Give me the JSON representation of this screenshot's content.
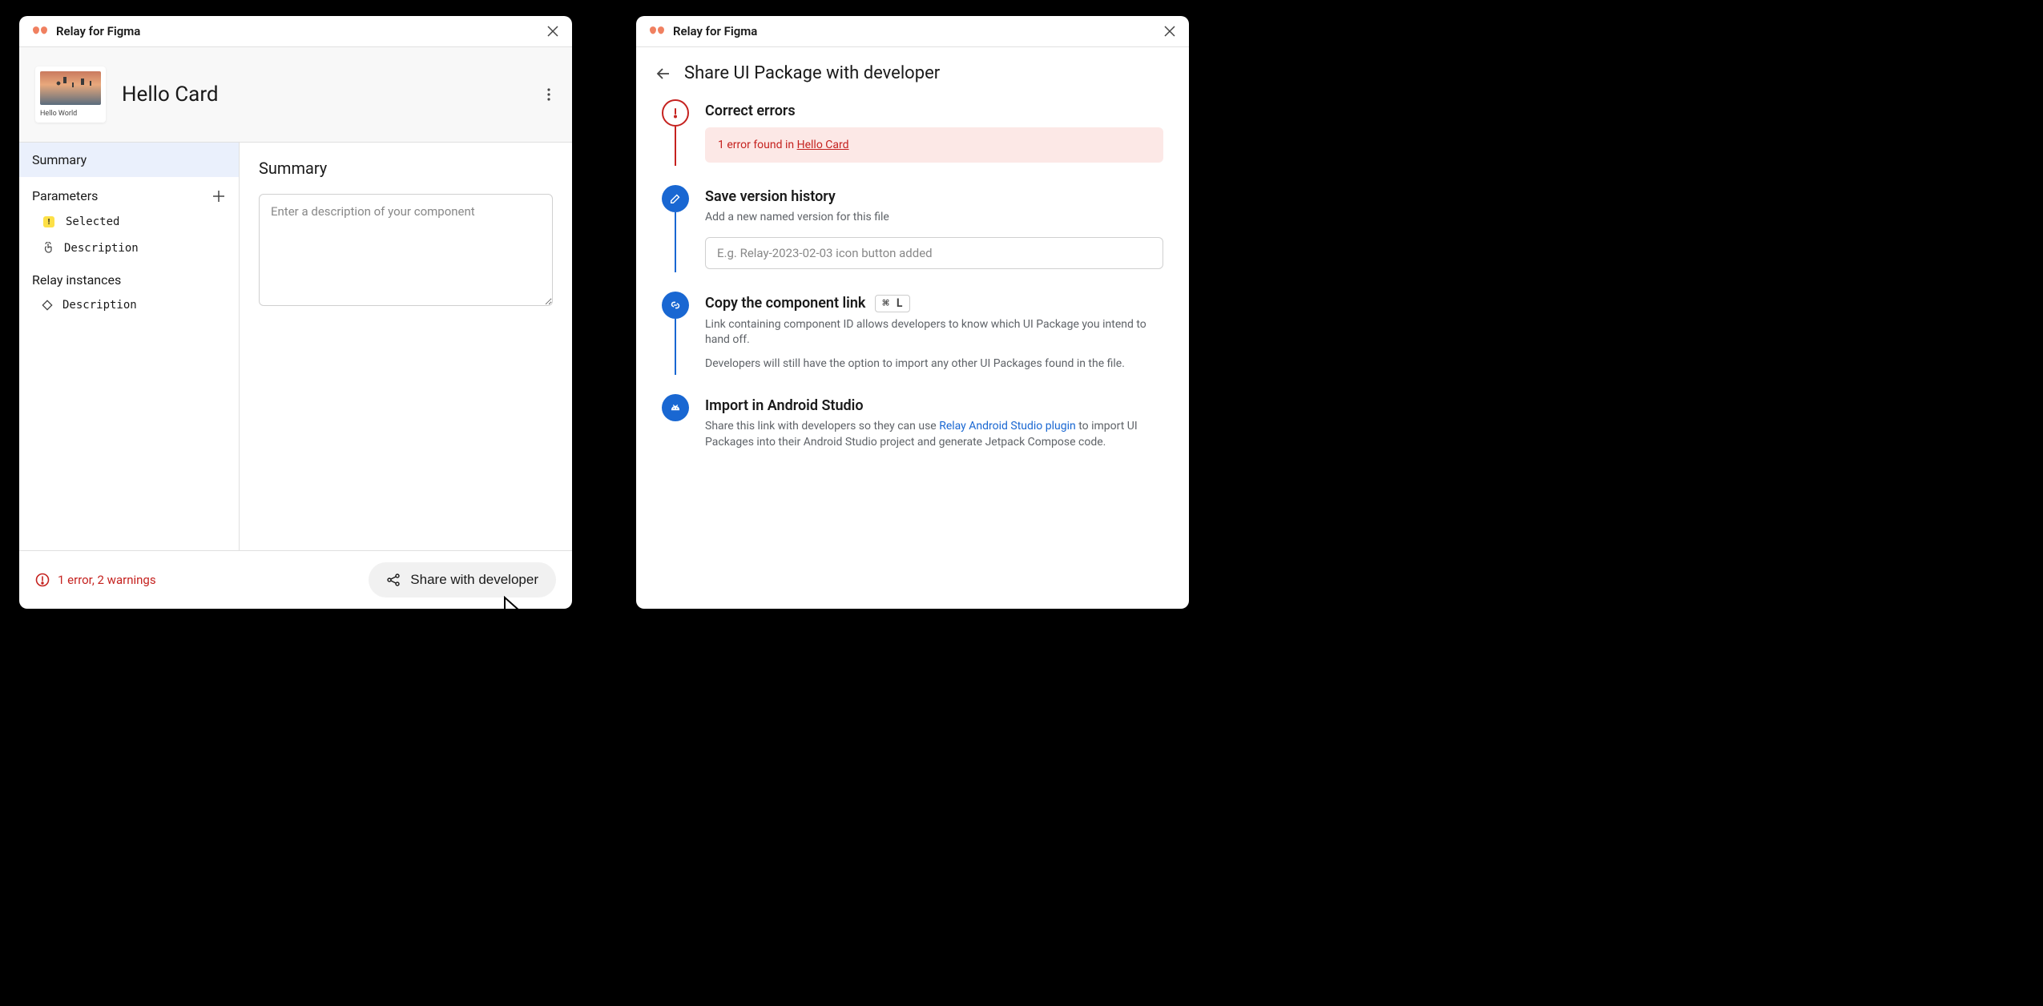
{
  "app_title": "Relay for Figma",
  "left": {
    "component_name": "Hello Card",
    "thumbnail_caption": "Hello World",
    "sidebar": {
      "summary_label": "Summary",
      "parameters_label": "Parameters",
      "param_items": [
        {
          "label": "Selected"
        },
        {
          "label": "Description"
        }
      ],
      "instances_label": "Relay instances",
      "instance_items": [
        {
          "label": "Description"
        }
      ]
    },
    "main": {
      "heading": "Summary",
      "description_placeholder": "Enter a description of your component"
    },
    "footer": {
      "error_text": "1 error, 2 warnings",
      "share_button": "Share with developer"
    }
  },
  "right": {
    "page_title": "Share UI Package with developer",
    "steps": {
      "correct_errors": {
        "title": "Correct errors",
        "banner_prefix": "1 error found in ",
        "banner_link": "Hello Card"
      },
      "save_version": {
        "title": "Save version history",
        "subtitle": "Add a new named version for this file",
        "input_placeholder": "E.g. Relay-2023-02-03 icon button added"
      },
      "copy_link": {
        "title": "Copy the component link",
        "shortcut": "⌘ L",
        "desc1": "Link containing component ID allows developers to know which UI Package you intend to hand off.",
        "desc2": "Developers will still have the option to import any other UI Packages found in the file."
      },
      "import": {
        "title": "Import in Android Studio",
        "desc_prefix": "Share this link with developers so they can use ",
        "desc_link": "Relay Android Studio plugin",
        "desc_suffix": " to import UI Packages into their Android Studio project and generate Jetpack Compose code."
      }
    }
  }
}
